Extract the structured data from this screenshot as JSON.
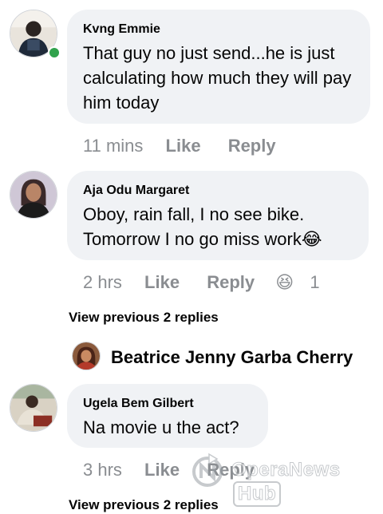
{
  "comments": [
    {
      "author": "Kvng Emmie",
      "text": "That guy no just send...he is just calculating how much they will pay him today",
      "time": "11 mins",
      "like": "Like",
      "reply": "Reply",
      "online": true
    },
    {
      "author": "Aja Odu Margaret",
      "text": "Oboy, rain fall, I no see bike. Tomorrow I no go miss work",
      "emoji": "😂",
      "time": "2 hrs",
      "like": "Like",
      "reply": "Reply",
      "reaction_emoji": "😆",
      "reaction_count": "1"
    },
    {
      "author": "Ugela Bem Gilbert",
      "text": "Na movie u the act?",
      "time": "3 hrs",
      "like": "Like",
      "reply": "Reply"
    }
  ],
  "view_previous_1": "View previous 2 replies",
  "reply_preview_author": "Beatrice Jenny Garba Cherry",
  "view_previous_2": "View previous 2 replies",
  "watermark": {
    "name": "OperaNews",
    "suffix": "Hub"
  },
  "colors": {
    "bubble": "#f0f2f5",
    "meta_text": "#8a8d91",
    "online": "#31a24c"
  }
}
